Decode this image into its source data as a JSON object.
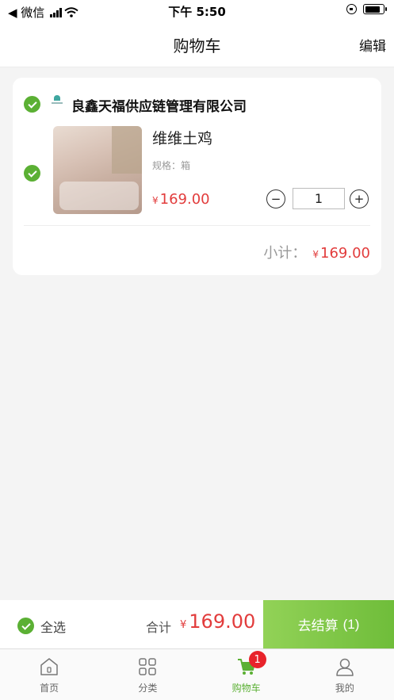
{
  "status_bar": {
    "back_app": "◀ 微信",
    "time": "下午 5:50"
  },
  "nav": {
    "title": "购物车",
    "edit_label": "编辑"
  },
  "store": {
    "name": "良鑫天福供应链管理有限公司",
    "checked": true
  },
  "product": {
    "name": "维维土鸡",
    "spec": "规格：箱",
    "price_symbol": "¥",
    "price": "169.00",
    "quantity": "1",
    "checked": true,
    "minus_label": "−",
    "plus_label": "+"
  },
  "subtotal": {
    "label": "小计：",
    "symbol": "¥",
    "amount": "169.00"
  },
  "checkout": {
    "select_all_label": "全选",
    "total_label": "合计",
    "total_symbol": "¥",
    "total_amount": "169.00",
    "button_label": "去结算",
    "button_count": "(1)"
  },
  "tabs": [
    {
      "label": "首页",
      "icon": "home-icon"
    },
    {
      "label": "分类",
      "icon": "category-icon"
    },
    {
      "label": "购物车",
      "icon": "cart-icon",
      "badge": "1",
      "active": true
    },
    {
      "label": "我的",
      "icon": "profile-icon"
    }
  ],
  "colors": {
    "accent": "#5bb034",
    "price": "#e23c3c",
    "badge": "#e8232b"
  }
}
